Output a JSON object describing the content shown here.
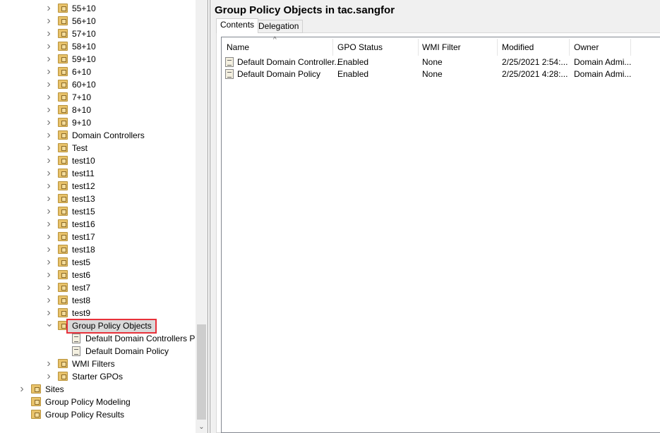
{
  "tree": {
    "ous": [
      "55+10",
      "56+10",
      "57+10",
      "58+10",
      "59+10",
      "6+10",
      "60+10",
      "7+10",
      "8+10",
      "9+10",
      "Domain Controllers",
      "Test",
      "test10",
      "test11",
      "test12",
      "test13",
      "test15",
      "test16",
      "test17",
      "test18",
      "test5",
      "test6",
      "test7",
      "test8",
      "test9"
    ],
    "gpo_container": "Group Policy Objects",
    "gpo_children": [
      "Default Domain Controllers P",
      "Default Domain Policy"
    ],
    "wmi": "WMI Filters",
    "starter": "Starter GPOs",
    "sites": "Sites",
    "modeling": "Group Policy Modeling",
    "results": "Group Policy Results"
  },
  "main": {
    "title": "Group Policy Objects in tac.sangfor",
    "tabs": [
      "Contents",
      "Delegation"
    ],
    "columns": [
      "Name",
      "GPO Status",
      "WMI Filter",
      "Modified",
      "Owner"
    ],
    "rows": [
      [
        "Default Domain Controller...",
        "Enabled",
        "None",
        "2/25/2021 2:54:...",
        "Domain Admi..."
      ],
      [
        "Default Domain Policy",
        "Enabled",
        "None",
        "2/25/2021 4:28:...",
        "Domain Admi..."
      ]
    ]
  },
  "colors": {
    "highlight": "#e8313a"
  }
}
